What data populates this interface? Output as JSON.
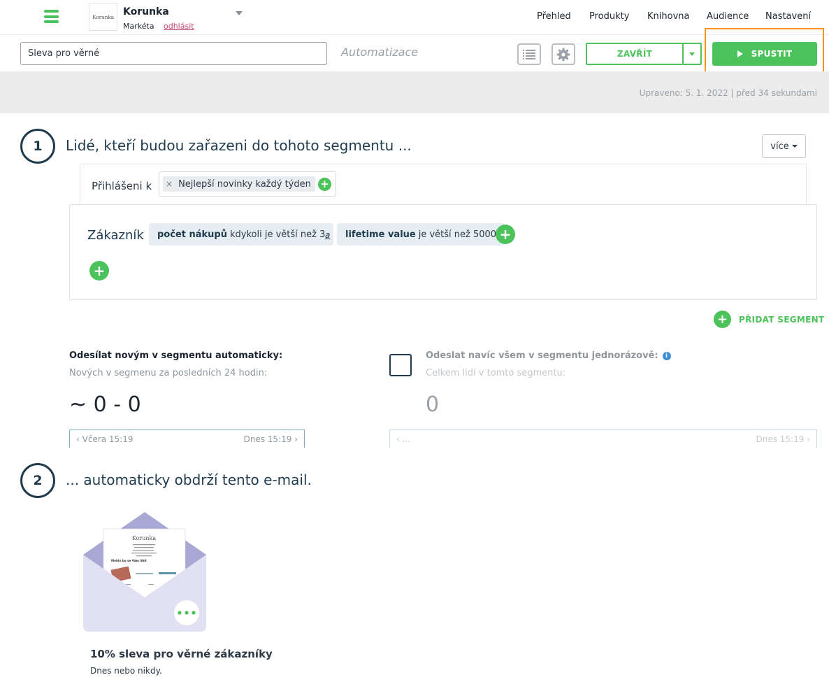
{
  "brand": {
    "logo_text": "Korunka",
    "name": "Korunka",
    "user": "Markéta",
    "logout": "odhlásit"
  },
  "nav": [
    "Přehled",
    "Produkty",
    "Knihovna",
    "Audience",
    "Nastavení"
  ],
  "toolbar": {
    "campaign_name": "Sleva pro věrné",
    "type_label": "Automatizace",
    "close_label": "ZAVŘÍT",
    "launch_label": "SPUSTIT"
  },
  "status": {
    "modified": "Upraveno: 5. 1. 2022 | před 34 sekundami"
  },
  "step1": {
    "number": "1",
    "title": "Lidé, kteří budou zařazeni do tohoto segmentu ...",
    "more_label": "více",
    "subscribed_label": "Přihlášeni k",
    "subscribed_tags": [
      "Nejlepší novinky každý týden"
    ],
    "customer_label": "Zákazník",
    "conditions": [
      {
        "bold": "počet nákupů",
        "text": "kdykoli je větší než 3"
      },
      {
        "bold": "lifetime value",
        "text": "je větší než 5000"
      }
    ],
    "and_label": "a",
    "add_segment_label": "PŘIDAT SEGMENT"
  },
  "auto_send": {
    "title": "Odesílat novým v segmentu automaticky:",
    "subtitle": "Nových v segmenu za posledních 24 hodin:",
    "count": "~ 0 - 0",
    "range_from": "Včera 15:19",
    "range_to": "Dnes 15:19"
  },
  "once_send": {
    "title": "Odeslat navíc všem v segmentu jednorázově:",
    "subtitle": "Celkem lidí v tomto segmentu:",
    "count": "0",
    "range_from": "...",
    "range_to": "Dnes 15:19"
  },
  "step2": {
    "number": "2",
    "title": "... automaticky obdrží tento e-mail.",
    "email_name": "10% sleva pro věrné zákazníky",
    "email_subject": "Dnes nebo nikdy.",
    "preview_logo": "Korunka",
    "preview_heading": "Mohlo by se Vám líbit"
  },
  "colors": {
    "accent_green": "#4cc35a",
    "heading_navy": "#1f3b4d",
    "highlight_orange": "#f7931e",
    "envelope_back": "#a9a7d3",
    "envelope_front": "#e2e0f3"
  }
}
